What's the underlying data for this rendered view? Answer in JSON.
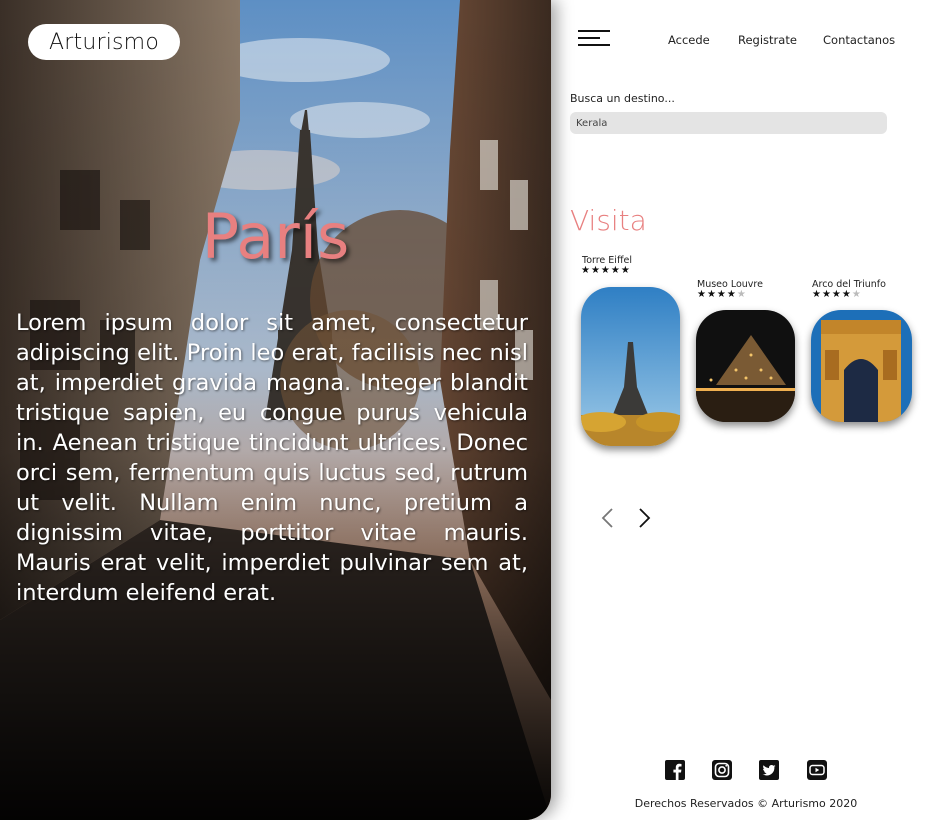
{
  "brand": {
    "name": "Arturismo"
  },
  "hero": {
    "title": "París",
    "description": "Lorem ipsum dolor sit amet, consectetur adipiscing elit. Proin leo erat, facilisis nec nisl at, imperdiet gravida magna. Integer blandit tristique sapien, eu congue purus vehicula in. Aenean tristique tincidunt ultrices. Donec orci sem, fermentum quis luctus sed, rutrum ut velit. Nullam enim nunc, pretium a dignissim vitae, porttitor vitae mauris. Mauris erat velit, imperdiet pulvinar sem at, interdum eleifend erat."
  },
  "nav": {
    "menu_icon": "hamburger-icon",
    "links": [
      "Accede",
      "Registrate",
      "Contactanos"
    ]
  },
  "search": {
    "label": "Busca un destino...",
    "value": "Kerala"
  },
  "visit": {
    "title": "Visita",
    "places": [
      {
        "name": "Torre Eiffel",
        "rating": 5,
        "max_rating": 5
      },
      {
        "name": "Museo Louvre",
        "rating": 4,
        "max_rating": 5
      },
      {
        "name": "Arco del Triunfo",
        "rating": 4,
        "max_rating": 5
      }
    ]
  },
  "carousel": {
    "prev_icon": "chevron-left-icon",
    "next_icon": "chevron-right-icon"
  },
  "social": [
    "facebook-icon",
    "instagram-icon",
    "twitter-icon",
    "youtube-icon"
  ],
  "footer": {
    "text": "Derechos Reservados © Arturismo 2020"
  },
  "colors": {
    "accent": "#e88080",
    "search_bg": "#e4e4e4"
  }
}
